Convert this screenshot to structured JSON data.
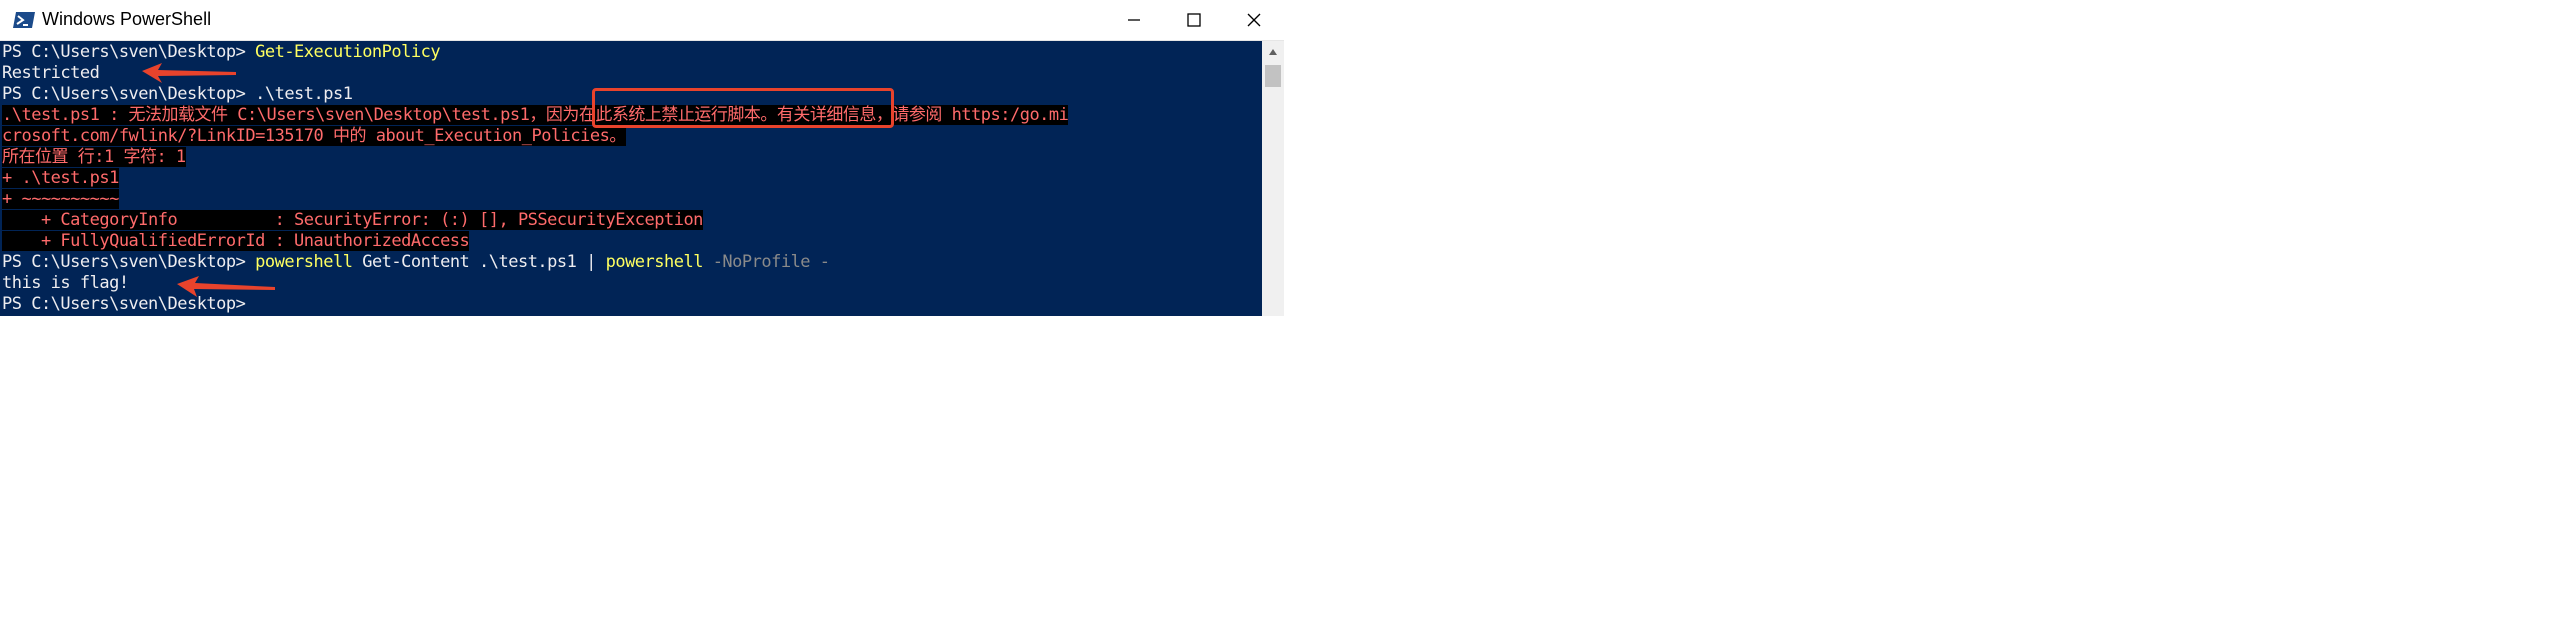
{
  "window": {
    "title": "Windows PowerShell"
  },
  "console": {
    "line1": {
      "prompt": "PS C:\\Users\\sven\\Desktop> ",
      "command": "Get-ExecutionPolicy"
    },
    "line2": {
      "text": "Restricted"
    },
    "line3": {
      "prompt": "PS C:\\Users\\sven\\Desktop> ",
      "command": ".\\test.ps1"
    },
    "error": {
      "line1": ".\\test.ps1 : 无法加载文件 C:\\Users\\sven\\Desktop\\test.ps1，因为在此系统上禁止运行脚本。有关详细信息，请参阅 https:/go.mi",
      "line2": "crosoft.com/fwlink/?LinkID=135170 中的 about_Execution_Policies。",
      "line3": "所在位置 行:1 字符: 1",
      "line4": "+ .\\test.ps1",
      "line5": "+ ~~~~~~~~~~",
      "line6": "    + CategoryInfo          : SecurityError: (:) [], PSSecurityException",
      "line7": "    + FullyQualifiedErrorId : UnauthorizedAccess"
    },
    "line4": {
      "prompt": "PS C:\\Users\\sven\\Desktop> ",
      "cmd1": "powershell",
      "args1": " Get-Content .\\test.ps1 ",
      "pipe": "|",
      "cmd2": " powershell",
      "params": " -NoProfile -"
    },
    "line5": {
      "text": "this is flag!"
    },
    "line6": {
      "prompt": "PS C:\\Users\\sven\\Desktop>"
    }
  },
  "icons": {
    "app": "powershell-icon",
    "minimize": "minimize-icon",
    "maximize": "maximize-icon",
    "close": "close-icon"
  },
  "colors": {
    "console_bg": "#012456",
    "command": "#ffff60",
    "error": "#ff6b6b",
    "annotation": "#e8432c"
  }
}
